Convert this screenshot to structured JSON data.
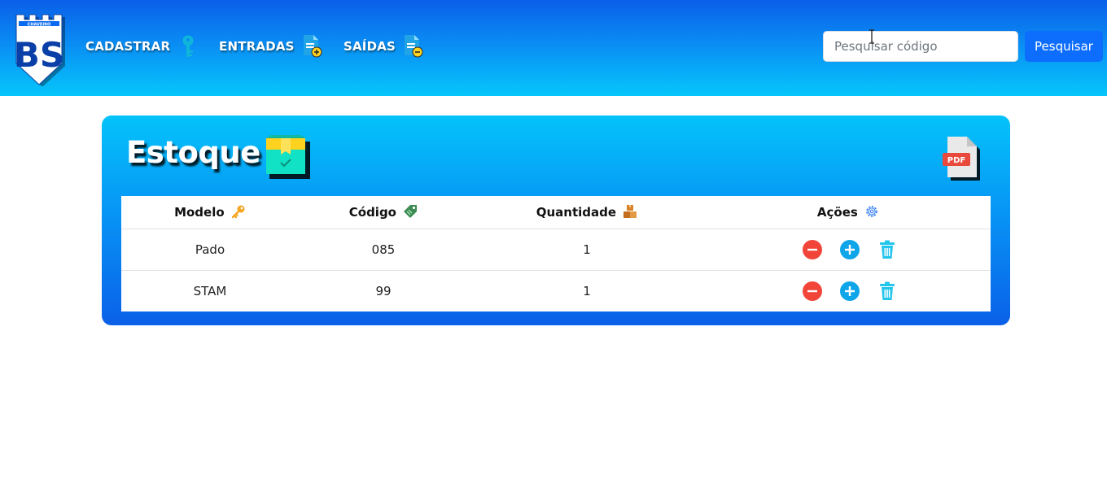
{
  "header": {
    "logo_text": "BS",
    "logo_subtext": "CHAVEIRO",
    "nav": [
      {
        "label": "CADASTRAR",
        "icon": "key-icon"
      },
      {
        "label": "ENTRADAS",
        "icon": "document-add-icon"
      },
      {
        "label": "SAÍDAS",
        "icon": "document-remove-icon"
      }
    ],
    "search": {
      "placeholder": "Pesquisar código",
      "value": "",
      "button_label": "Pesquisar"
    }
  },
  "stock": {
    "title": "Estoque",
    "title_icon": "box-icon",
    "pdf_icon": "pdf-icon",
    "pdf_label": "PDF",
    "columns": [
      {
        "label": "Modelo",
        "icon": "key-icon"
      },
      {
        "label": "Código",
        "icon": "tag-icon"
      },
      {
        "label": "Quantidade",
        "icon": "boxes-icon"
      },
      {
        "label": "Ações",
        "icon": "gear-icon"
      }
    ],
    "rows": [
      {
        "modelo": "Pado",
        "codigo": "085",
        "quantidade": "1"
      },
      {
        "modelo": "STAM",
        "codigo": "99",
        "quantidade": "1"
      }
    ]
  },
  "colors": {
    "header_top": "#0a5fe8",
    "header_bottom": "#06c6fb",
    "button": "#0d6efd",
    "minus": "#f2453a",
    "plus": "#0ea5e9",
    "trash": "#22c5ec"
  }
}
